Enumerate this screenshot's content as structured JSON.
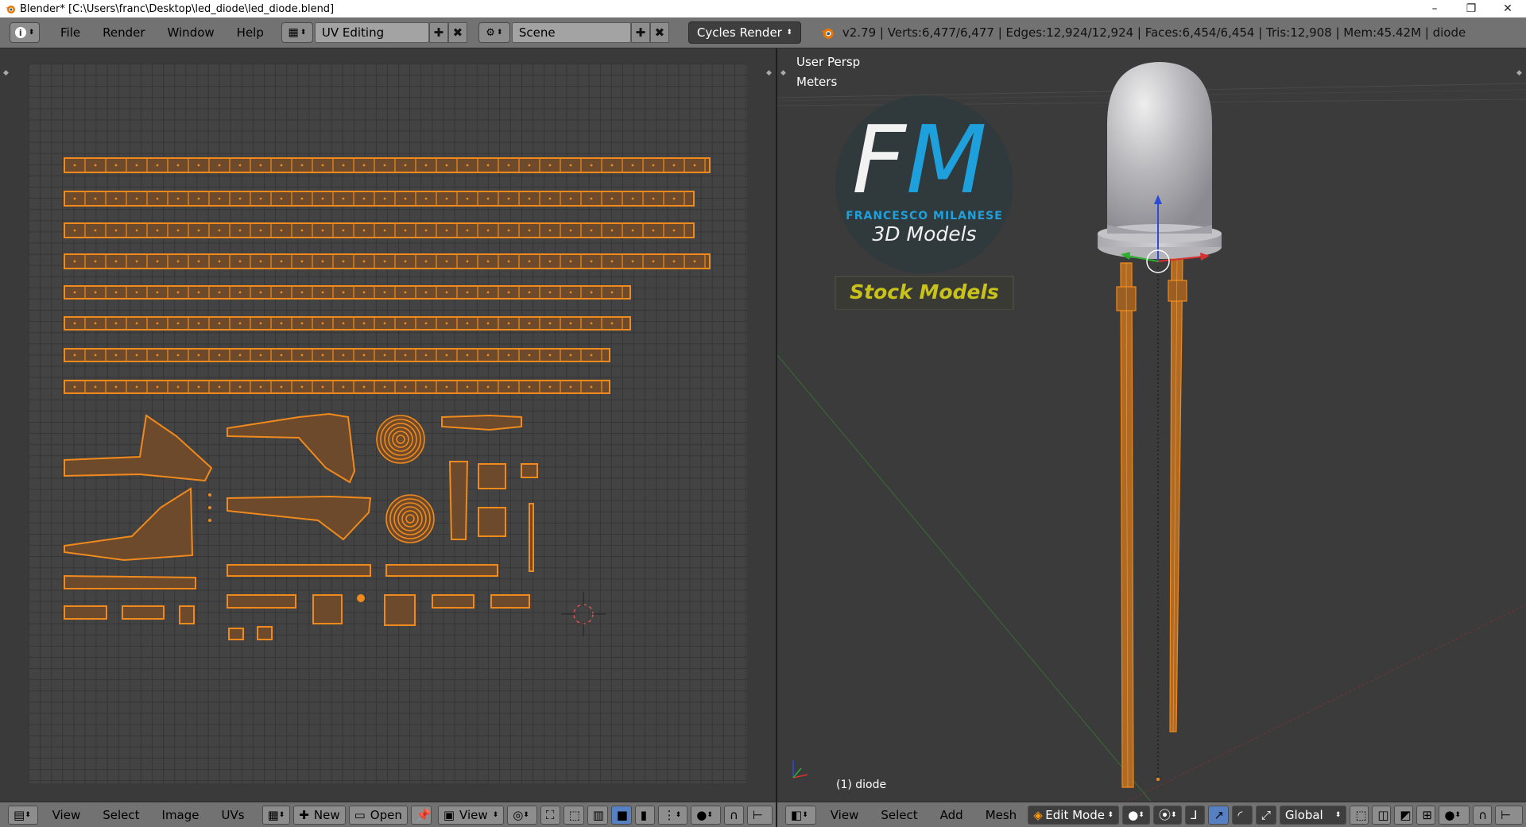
{
  "titlebar": {
    "title": "Blender* [C:\\Users\\franc\\Desktop\\led_diode\\led_diode.blend]",
    "minimize": "–",
    "restore": "❐",
    "close": "✕"
  },
  "info_header": {
    "menu": [
      "File",
      "Render",
      "Window",
      "Help"
    ],
    "screen_layout": "UV Editing",
    "scene": "Scene",
    "render_engine": "Cycles Render",
    "stats": "v2.79 | Verts:6,477/6,477 | Edges:12,924/12,924 | Faces:6,454/6,454 | Tris:12,908 | Mem:45.42M | diode"
  },
  "uv_editor": {
    "menu": [
      "View",
      "Select",
      "Image",
      "UVs"
    ],
    "new_label": "New",
    "open_label": "Open",
    "view_label": "View"
  },
  "viewport": {
    "view_name": "User Persp",
    "units": "Meters",
    "object_label": "(1) diode",
    "menu": [
      "View",
      "Select",
      "Add",
      "Mesh"
    ],
    "mode": "Edit Mode",
    "orientation": "Global"
  },
  "watermark": {
    "initials_f": "F",
    "initials_m": "M",
    "author": "FRANCESCO MILANESE",
    "subtitle": "3D Models",
    "banner": "Stock Models"
  },
  "colors": {
    "uv_orange": "#f08a1c",
    "uv_fill": "#6e4a2c",
    "logo_blue": "#1ea0dc",
    "banner_yellow": "#c9c21b"
  }
}
